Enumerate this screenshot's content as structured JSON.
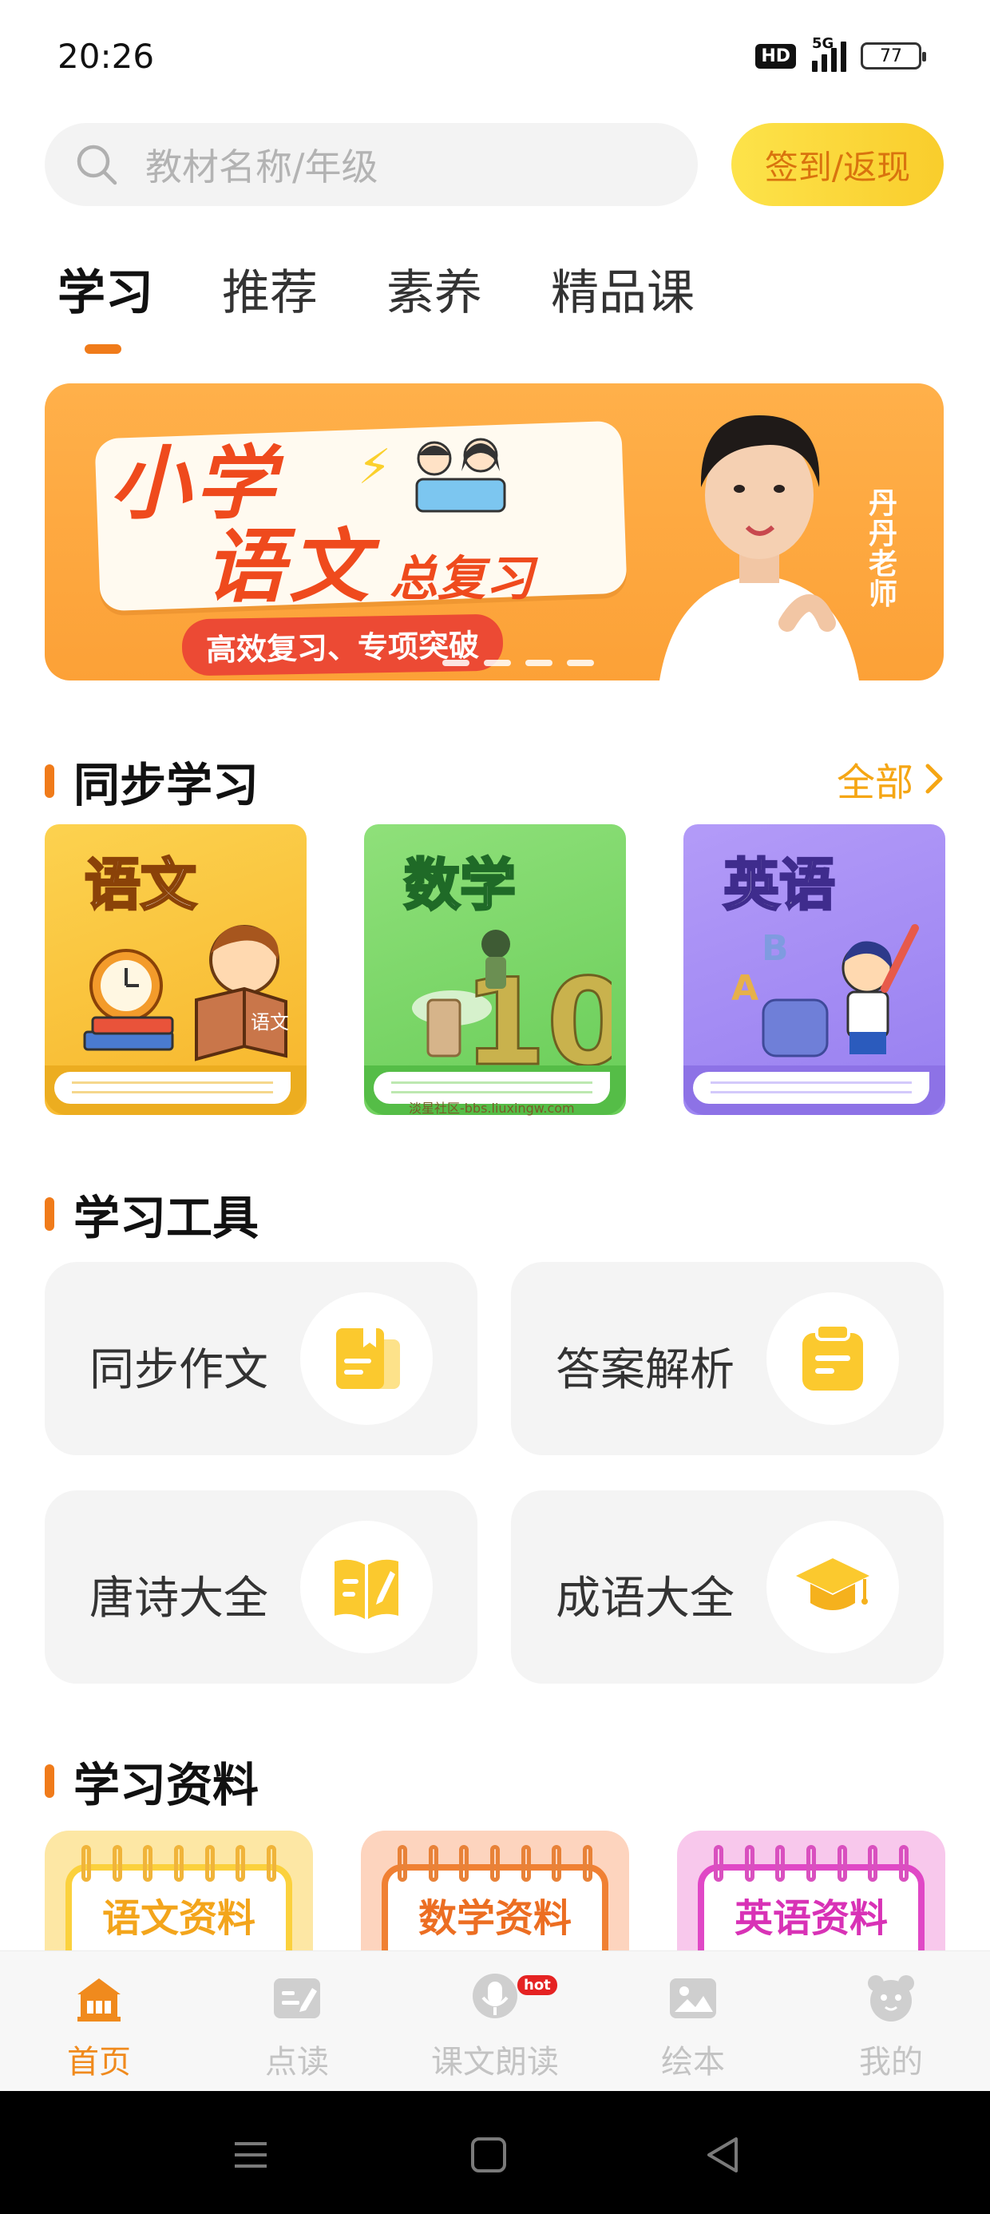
{
  "status_bar": {
    "time": "20:26",
    "hd_label": "HD",
    "network": "5G",
    "battery": "77"
  },
  "search": {
    "placeholder": "教材名称/年级",
    "signin_label": "签到/返现"
  },
  "tabs": [
    {
      "label": "学习",
      "active": true
    },
    {
      "label": "推荐",
      "active": false
    },
    {
      "label": "素养",
      "active": false
    },
    {
      "label": "精品课",
      "active": false
    }
  ],
  "banner": {
    "title_line1": "小学",
    "title_line2": "语文",
    "title_suffix": "总复习",
    "subtitle": "高效复习、专项突破",
    "teacher": "丹丹老师",
    "slide_count": 4
  },
  "sync_study": {
    "title": "同步学习",
    "see_all": "全部",
    "books": [
      {
        "label": "语文",
        "cover_text": "语文",
        "color": "#f7b52b"
      },
      {
        "label": "数学",
        "color": "#69cd58"
      },
      {
        "label": "英语",
        "color": "#977ff0"
      }
    ],
    "watermark": "淡星社区-bbs.liuxingw.com"
  },
  "tools": {
    "title": "学习工具",
    "items": [
      {
        "label": "同步作文",
        "icon": "book-icon"
      },
      {
        "label": "答案解析",
        "icon": "clipboard-icon"
      },
      {
        "label": "唐诗大全",
        "icon": "open-book-pen-icon"
      },
      {
        "label": "成语大全",
        "icon": "graduation-cap-icon"
      }
    ]
  },
  "materials": {
    "title": "学习资料",
    "items": [
      {
        "label": "语文资料"
      },
      {
        "label": "数学资料"
      },
      {
        "label": "英语资料"
      }
    ]
  },
  "bottom_nav": {
    "items": [
      {
        "label": "首页",
        "icon": "home-icon",
        "active": true
      },
      {
        "label": "点读",
        "icon": "point-read-icon",
        "active": false
      },
      {
        "label": "课文朗读",
        "icon": "microphone-icon",
        "active": false,
        "badge": "hot"
      },
      {
        "label": "绘本",
        "icon": "picture-book-icon",
        "active": false
      },
      {
        "label": "我的",
        "icon": "profile-icon",
        "active": false
      }
    ]
  },
  "colors": {
    "accent": "#f07b1a",
    "signin_text": "#d9730e",
    "see_all": "#f5a614",
    "nav_active": "#f08a1d",
    "nav_inactive": "#c3c3c3",
    "tool_icon": "#fbc92e"
  }
}
